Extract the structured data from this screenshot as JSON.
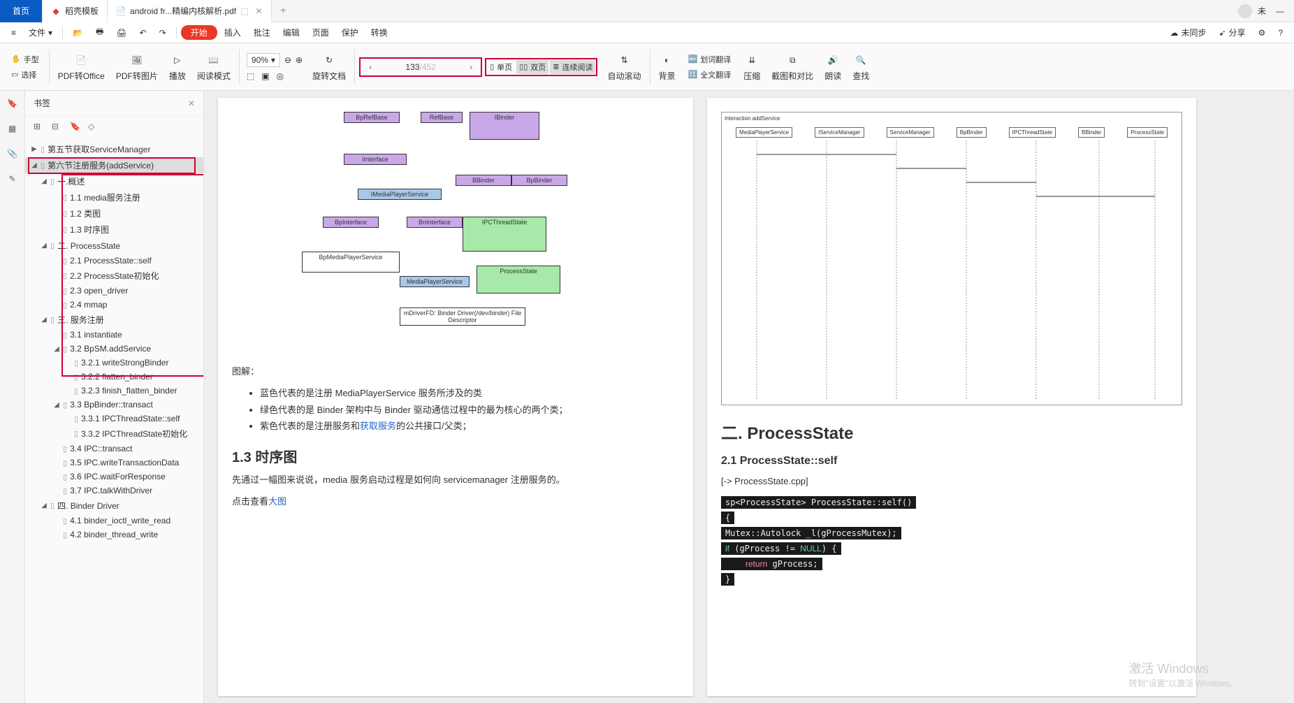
{
  "tabs": {
    "home": "首页",
    "stash": "稻壳模板",
    "active": "android fr...精编内核解析.pdf"
  },
  "user": {
    "name": "未"
  },
  "menu": {
    "file": "文件",
    "start": "开始",
    "insert": "插入",
    "review": "批注",
    "edit": "编辑",
    "page": "页面",
    "protect": "保护",
    "convert": "转换",
    "nosync": "未同步",
    "share": "分享"
  },
  "toolbar": {
    "hand": "手型",
    "select": "选择",
    "pdf2office": "PDF转Office",
    "pdf2img": "PDF转图片",
    "play": "播放",
    "readmode": "阅读模式",
    "zoom": "90%",
    "rotate": "旋转文档",
    "page_current": "133",
    "page_total": "/452",
    "single": "单页",
    "double": "双页",
    "continuous": "连续阅读",
    "autoscroll": "自动滚动",
    "bg": "背景",
    "wordtrans": "划词翻译",
    "fulltrans": "全文翻译",
    "compress": "压缩",
    "compare": "截图和对比",
    "read": "朗读",
    "find": "查找"
  },
  "sidebar": {
    "title": "书签",
    "items": [
      {
        "level": 0,
        "caret": "▶",
        "text": "第五节获取ServiceManager",
        "sel": false
      },
      {
        "level": 0,
        "caret": "◢",
        "text": "第六节注册服务(addService)",
        "sel": true
      },
      {
        "level": 1,
        "caret": "◢",
        "text": "一.概述",
        "sel": false
      },
      {
        "level": 2,
        "caret": "",
        "text": "1.1 media服务注册",
        "sel": false
      },
      {
        "level": 2,
        "caret": "",
        "text": "1.2 类图",
        "sel": false
      },
      {
        "level": 2,
        "caret": "",
        "text": "1.3 时序图",
        "sel": false
      },
      {
        "level": 1,
        "caret": "◢",
        "text": "二. ProcessState",
        "sel": false
      },
      {
        "level": 2,
        "caret": "",
        "text": "2.1 ProcessState::self",
        "sel": false
      },
      {
        "level": 2,
        "caret": "",
        "text": "2.2 ProcessState初始化",
        "sel": false
      },
      {
        "level": 2,
        "caret": "",
        "text": "2.3 open_driver",
        "sel": false
      },
      {
        "level": 2,
        "caret": "",
        "text": "2.4 mmap",
        "sel": false
      },
      {
        "level": 1,
        "caret": "◢",
        "text": "三. 服务注册",
        "sel": false
      },
      {
        "level": 2,
        "caret": "",
        "text": "3.1 instantiate",
        "sel": false
      },
      {
        "level": 2,
        "caret": "◢",
        "text": "3.2 BpSM.addService",
        "sel": false
      },
      {
        "level": 3,
        "caret": "",
        "text": "3.2.1 writeStrongBinder",
        "sel": false
      },
      {
        "level": 3,
        "caret": "",
        "text": "3.2.2 flatten_binder",
        "sel": false
      },
      {
        "level": 3,
        "caret": "",
        "text": "3.2.3 finish_flatten_binder",
        "sel": false
      },
      {
        "level": 2,
        "caret": "◢",
        "text": "3.3 BpBinder::transact",
        "sel": false
      },
      {
        "level": 3,
        "caret": "",
        "text": "3.3.1 IPCThreadState::self",
        "sel": false
      },
      {
        "level": 3,
        "caret": "",
        "text": "3.3.2 IPCThreadState初始化",
        "sel": false
      },
      {
        "level": 2,
        "caret": "",
        "text": "3.4 IPC::transact",
        "sel": false
      },
      {
        "level": 2,
        "caret": "",
        "text": "3.5 IPC.writeTransactionData",
        "sel": false
      },
      {
        "level": 2,
        "caret": "",
        "text": "3.6 IPC.waitForResponse",
        "sel": false
      },
      {
        "level": 2,
        "caret": "",
        "text": "3.7 IPC.talkWithDriver",
        "sel": false
      },
      {
        "level": 1,
        "caret": "◢",
        "text": "四. Binder Driver",
        "sel": false
      },
      {
        "level": 2,
        "caret": "",
        "text": "4.1 binder_ioctl_write_read",
        "sel": false
      },
      {
        "level": 2,
        "caret": "",
        "text": "4.2 binder_thread_write",
        "sel": false
      }
    ]
  },
  "doc": {
    "legend_title": "图解：",
    "legend1": "蓝色代表的是注册 MediaPlayerService 服务所涉及的类",
    "legend2": "绿色代表的是 Binder 架构中与 Binder 驱动通信过程中的最为核心的两个类；",
    "legend3a": "紫色代表的是注册服务和",
    "legend3_link": "获取服务",
    "legend3b": "的公共接口/父类；",
    "h_seq": "1.3  时序图",
    "seq_desc": "先通过一幅图来说说，media 服务启动过程是如何向 servicemanager 注册服务的。",
    "big_img_a": "点击查看",
    "big_img_link": "大图",
    "h_ps": "二. ProcessState",
    "h_ps_self": "2.1 ProcessState::self",
    "ps_file": "[-> ProcessState.cpp]",
    "code1": "sp<ProcessState> ProcessState::self()",
    "code2": "{",
    "code3": "    Mutex::Autolock _l(gProcessMutex);",
    "code4": "    if (gProcess != NULL) {",
    "code5": "        return gProcess;",
    "code6": "    }",
    "uml": {
      "bprefbase": "BpRefBase",
      "ibinder": "IBinder",
      "refbase": "RefBase",
      "iinterface": "IInterface",
      "bbinder": "BBinder",
      "bpbinder": "BpBinder",
      "imps": "IMediaPlayerService",
      "bninterface": "BnInterface",
      "bpinterface": "BpInterface",
      "ipcts": "IPCThreadState",
      "processstate": "ProcessState",
      "bpmps": "BpMediaPlayerService",
      "mps": "MediaPlayerService",
      "driver": "mDriverFD: Binder Driver(/dev/binder) File Descriptor"
    },
    "seq": {
      "title": "Interaction addService",
      "h1": "MediaPlayerService",
      "h2": "IServiceManager",
      "h3": "ServiceManager",
      "h4": "BpBinder",
      "h5": "IPCThreadState",
      "h6": "BBinder",
      "h7": "ProcessState"
    }
  },
  "watermark": {
    "title": "激活 Windows",
    "sub": "转到\"设置\"以激活 Windows。"
  }
}
